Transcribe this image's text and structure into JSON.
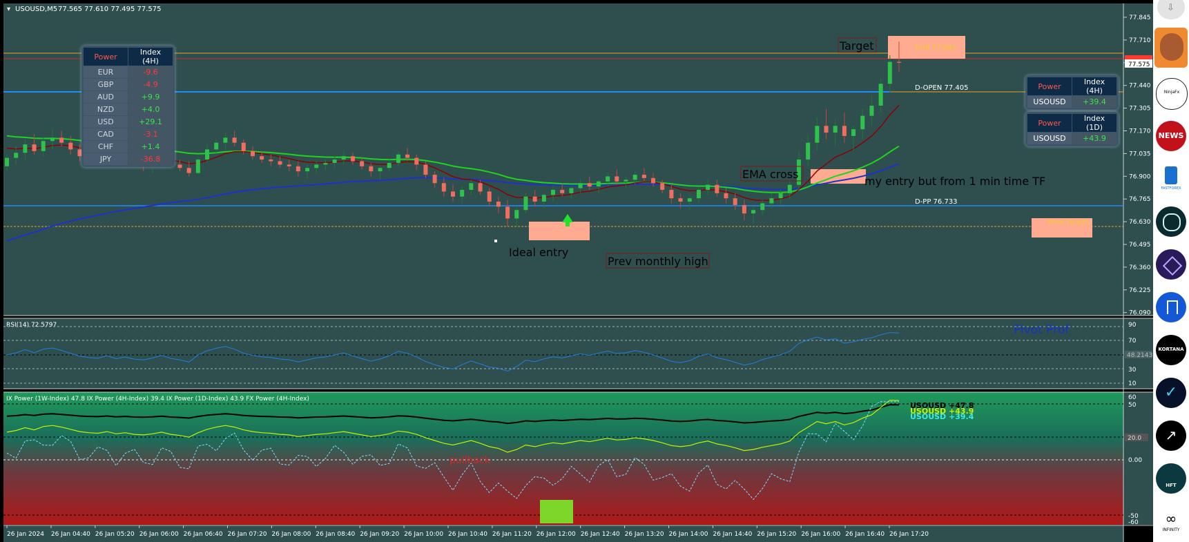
{
  "title": {
    "symbol_tf": "USOUSD,M5",
    "ohlc": "77.565 77.610 77.495 77.575"
  },
  "price_axis": {
    "ticks": [
      "77.845",
      "77.710",
      "77.575",
      "77.440",
      "77.305",
      "77.170",
      "77.035",
      "76.900",
      "76.765",
      "76.630",
      "76.495",
      "76.360",
      "76.225",
      "76.090"
    ],
    "current": "77.575",
    "current_color": "#ff3b30"
  },
  "time_axis": {
    "ticks": [
      "26 Jan 2024",
      "26 Jan 04:40",
      "26 Jan 05:20",
      "26 Jan 06:00",
      "26 Jan 06:40",
      "26 Jan 07:20",
      "26 Jan 08:00",
      "26 Jan 08:40",
      "26 Jan 09:20",
      "26 Jan 10:00",
      "26 Jan 10:40",
      "26 Jan 11:20",
      "26 Jan 12:00",
      "26 Jan 12:40",
      "26 Jan 13:20",
      "26 Jan 14:00",
      "26 Jan 14:40",
      "26 Jan 15:20",
      "26 Jan 16:00",
      "26 Jan 16:40",
      "26 Jan 17:20"
    ]
  },
  "levels": {
    "d_open": "D-OPEN 77.405",
    "d_pp": "D-PP 76.733",
    "d_hi": "D-Hi 77.841",
    "m_hi": "M-Hi 76.621"
  },
  "annotations": {
    "target": "Target",
    "ema_cross": "EMA cross",
    "my_entry": "my entry but from 1 min time TF",
    "ideal_entry": "Ideal entry",
    "prev_monthly_high": "Prev monthly high",
    "pullback": "pullback",
    "brand": "Pivot Prof"
  },
  "power_table": {
    "head": [
      "Power",
      "Index (4H)"
    ],
    "rows": [
      {
        "cur": "EUR",
        "val": "-9.6",
        "color": "#ff3b3b"
      },
      {
        "cur": "GBP",
        "val": "-4.9",
        "color": "#ff3b3b"
      },
      {
        "cur": "AUD",
        "val": "+9.9",
        "color": "#37e64a"
      },
      {
        "cur": "NZD",
        "val": "+4.0",
        "color": "#37e64a"
      },
      {
        "cur": "USD",
        "val": "+29.1",
        "color": "#37e64a"
      },
      {
        "cur": "CAD",
        "val": "-3.1",
        "color": "#ff3b3b"
      },
      {
        "cur": "CHF",
        "val": "+1.4",
        "color": "#37e64a"
      },
      {
        "cur": "JPY",
        "val": "-36.8",
        "color": "#ff3b3b"
      }
    ]
  },
  "index_4h": {
    "head": [
      "Power",
      "Index (4H)"
    ],
    "cur": "USOUSD",
    "val": "+39.4"
  },
  "index_1d": {
    "head": [
      "Power",
      "Index (1D)"
    ],
    "cur": "USOUSD",
    "val": "+43.9"
  },
  "rsi": {
    "label": "RSI(14) 72.5797",
    "levels": [
      "90",
      "70",
      "50",
      "30",
      "10"
    ],
    "marker": "48.2143"
  },
  "ix": {
    "label": "IX Power (1W-Index) 47.8  IX Power (4H-Index) 39.4  IX Power (1D-Index) 43.9  FX Power (4H-Index)",
    "series_labels": [
      {
        "text": "USOUSD +47.8",
        "color": "#000000"
      },
      {
        "text": "USOUSD +43.9",
        "color": "#c8f000"
      },
      {
        "text": "USOUSD +39.4",
        "color": "#3fe8e8"
      }
    ],
    "levels": [
      "60",
      "50",
      "20.0",
      "0.00",
      "-50",
      "-60"
    ]
  },
  "sidebar": [
    {
      "icon": "download-icon"
    },
    {
      "icon": "avatar-icon"
    },
    {
      "icon": "ninjafx-logo-icon",
      "text": "NinjaFx"
    },
    {
      "icon": "news-icon",
      "text": "NEWS"
    },
    {
      "icon": "fastforex-logo-icon",
      "text": "FASTFOREX"
    },
    {
      "icon": "circle-logo-icon"
    },
    {
      "icon": "diamond-logo-icon"
    },
    {
      "icon": "bookmark-icon"
    },
    {
      "icon": "kortana-logo-icon",
      "text": "KORTANA"
    },
    {
      "icon": "check-logo-icon"
    },
    {
      "icon": "chart-up-icon"
    },
    {
      "icon": "hft-logo-icon",
      "text": "HFT"
    },
    {
      "icon": "infinity-logo-icon",
      "text": "INFINITY"
    }
  ],
  "colors": {
    "bg": "#2f4f4f",
    "bull": "#2fc24a",
    "bear": "#f06e5e",
    "ema_fast": "#8b0000",
    "ema_slow": "#1ed41e",
    "ema_long": "#1e32c8",
    "pivot_line": "#1e6fff",
    "zone": "#ffab91",
    "grid_text": "#ffffff",
    "rsi_line": "#1f7fe0"
  },
  "chart_data": {
    "type": "candlestick",
    "timeframe": "M5",
    "ylim": [
      76.09,
      77.845
    ],
    "last_price": 77.575,
    "ohlc": [
      [
        76.96,
        77.03,
        76.93,
        77.01
      ],
      [
        77.01,
        77.08,
        76.97,
        77.04
      ],
      [
        77.04,
        77.12,
        77.0,
        77.09
      ],
      [
        77.09,
        77.15,
        77.03,
        77.05
      ],
      [
        77.05,
        77.13,
        77.02,
        77.11
      ],
      [
        77.11,
        77.18,
        77.06,
        77.13
      ],
      [
        77.13,
        77.17,
        77.08,
        77.1
      ],
      [
        77.1,
        77.14,
        77.03,
        77.06
      ],
      [
        77.06,
        77.09,
        76.99,
        77.02
      ],
      [
        77.02,
        77.06,
        76.98,
        77.0
      ],
      [
        77.0,
        77.04,
        76.96,
        76.99
      ],
      [
        76.99,
        77.04,
        76.96,
        77.02
      ],
      [
        77.02,
        77.05,
        76.97,
        76.98
      ],
      [
        76.98,
        77.02,
        76.95,
        77.0
      ],
      [
        77.0,
        77.03,
        76.96,
        76.97
      ],
      [
        76.97,
        77.0,
        76.93,
        76.96
      ],
      [
        76.96,
        77.0,
        76.92,
        76.98
      ],
      [
        76.98,
        77.02,
        76.95,
        77.01
      ],
      [
        77.01,
        77.02,
        76.96,
        76.97
      ],
      [
        76.97,
        77.0,
        76.93,
        76.95
      ],
      [
        76.95,
        76.99,
        76.9,
        76.92
      ],
      [
        76.92,
        77.02,
        76.91,
        77.0
      ],
      [
        77.0,
        77.09,
        76.98,
        77.06
      ],
      [
        77.06,
        77.12,
        77.03,
        77.1
      ],
      [
        77.1,
        77.16,
        77.06,
        77.13
      ],
      [
        77.13,
        77.17,
        77.08,
        77.1
      ],
      [
        77.1,
        77.12,
        77.03,
        77.05
      ],
      [
        77.05,
        77.08,
        77.0,
        77.02
      ],
      [
        77.02,
        77.05,
        76.98,
        77.0
      ],
      [
        77.0,
        77.03,
        76.96,
        76.99
      ],
      [
        76.99,
        77.02,
        76.95,
        76.97
      ],
      [
        76.97,
        77.0,
        76.93,
        76.96
      ],
      [
        76.96,
        76.99,
        76.9,
        76.93
      ],
      [
        76.93,
        76.97,
        76.89,
        76.95
      ],
      [
        76.95,
        76.99,
        76.92,
        76.97
      ],
      [
        76.97,
        77.0,
        76.94,
        76.98
      ],
      [
        76.98,
        77.02,
        76.95,
        77.0
      ],
      [
        77.0,
        77.05,
        76.97,
        77.02
      ],
      [
        77.02,
        77.04,
        76.97,
        76.99
      ],
      [
        76.99,
        77.01,
        76.94,
        76.96
      ],
      [
        76.96,
        76.98,
        76.9,
        76.93
      ],
      [
        76.93,
        76.96,
        76.88,
        76.95
      ],
      [
        76.95,
        77.0,
        76.93,
        76.98
      ],
      [
        76.98,
        77.05,
        76.96,
        77.03
      ],
      [
        77.03,
        77.07,
        76.99,
        77.01
      ],
      [
        77.01,
        77.03,
        76.94,
        76.97
      ],
      [
        76.97,
        76.99,
        76.89,
        76.91
      ],
      [
        76.91,
        76.93,
        76.83,
        76.86
      ],
      [
        76.86,
        76.89,
        76.78,
        76.81
      ],
      [
        76.81,
        76.85,
        76.75,
        76.78
      ],
      [
        76.78,
        76.84,
        76.74,
        76.82
      ],
      [
        76.82,
        76.88,
        76.79,
        76.86
      ],
      [
        76.86,
        76.88,
        76.79,
        76.81
      ],
      [
        76.81,
        76.83,
        76.72,
        76.75
      ],
      [
        76.75,
        76.78,
        76.68,
        76.72
      ],
      [
        76.72,
        76.76,
        76.6,
        76.65
      ],
      [
        76.65,
        76.72,
        76.6,
        76.7
      ],
      [
        76.7,
        76.8,
        76.68,
        76.78
      ],
      [
        76.78,
        76.82,
        76.72,
        76.75
      ],
      [
        76.75,
        76.8,
        76.71,
        76.79
      ],
      [
        76.79,
        76.84,
        76.75,
        76.82
      ],
      [
        76.82,
        76.86,
        76.78,
        76.8
      ],
      [
        76.8,
        76.84,
        76.77,
        76.83
      ],
      [
        76.83,
        76.88,
        76.8,
        76.86
      ],
      [
        76.86,
        76.9,
        76.82,
        76.84
      ],
      [
        76.84,
        76.88,
        76.8,
        76.87
      ],
      [
        76.87,
        76.92,
        76.84,
        76.9
      ],
      [
        76.9,
        76.94,
        76.85,
        76.87
      ],
      [
        76.87,
        76.9,
        76.83,
        76.88
      ],
      [
        76.88,
        76.93,
        76.85,
        76.91
      ],
      [
        76.91,
        76.95,
        76.87,
        76.89
      ],
      [
        76.89,
        76.92,
        76.84,
        76.86
      ],
      [
        76.86,
        76.88,
        76.8,
        76.82
      ],
      [
        76.82,
        76.85,
        76.74,
        76.77
      ],
      [
        76.77,
        76.8,
        76.71,
        76.75
      ],
      [
        76.75,
        76.79,
        76.7,
        76.77
      ],
      [
        76.77,
        76.84,
        76.74,
        76.82
      ],
      [
        76.82,
        76.88,
        76.79,
        76.85
      ],
      [
        76.85,
        76.88,
        76.78,
        76.8
      ],
      [
        76.8,
        76.83,
        76.74,
        76.77
      ],
      [
        76.77,
        76.8,
        76.7,
        76.73
      ],
      [
        76.73,
        76.76,
        76.64,
        76.68
      ],
      [
        76.68,
        76.72,
        76.62,
        76.7
      ],
      [
        76.7,
        76.76,
        76.67,
        76.74
      ],
      [
        76.74,
        76.8,
        76.71,
        76.77
      ],
      [
        76.77,
        76.82,
        76.73,
        76.8
      ],
      [
        76.8,
        76.88,
        76.77,
        76.85
      ],
      [
        76.85,
        77.05,
        76.82,
        77.0
      ],
      [
        77.0,
        77.15,
        76.96,
        77.1
      ],
      [
        77.1,
        77.25,
        77.05,
        77.2
      ],
      [
        77.2,
        77.3,
        77.12,
        77.16
      ],
      [
        77.16,
        77.24,
        77.08,
        77.2
      ],
      [
        77.2,
        77.28,
        77.1,
        77.14
      ],
      [
        77.14,
        77.2,
        77.05,
        77.18
      ],
      [
        77.18,
        77.3,
        77.12,
        77.26
      ],
      [
        77.26,
        77.38,
        77.2,
        77.32
      ],
      [
        77.32,
        77.48,
        77.28,
        77.45
      ],
      [
        77.45,
        77.62,
        77.4,
        77.58
      ],
      [
        77.58,
        77.7,
        77.52,
        77.575
      ]
    ],
    "overlays": [
      "EMA fast (dark red)",
      "EMA slow (green)",
      "EMA long (blue)"
    ],
    "rsi_last": 72.5797,
    "ix_power": {
      "1W": 47.8,
      "4H": 39.4,
      "1D": 43.9
    }
  }
}
